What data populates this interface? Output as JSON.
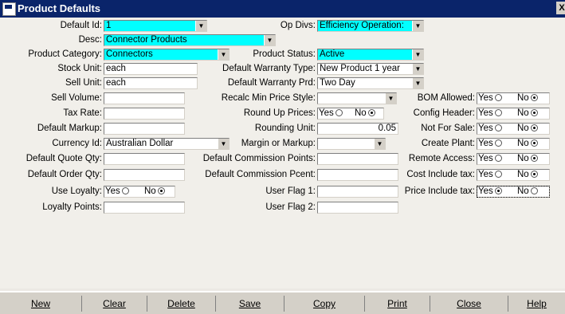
{
  "window": {
    "title": "Product Defaults",
    "close_glyph": "X"
  },
  "form": {
    "default_id": {
      "label": "Default Id:",
      "value": "1"
    },
    "op_divs": {
      "label": "Op Divs:",
      "value": "Efficiency Operation:"
    },
    "desc": {
      "label": "Desc:",
      "value": "Connector Products"
    },
    "product_category": {
      "label": "Product Category:",
      "value": "Connectors"
    },
    "product_status": {
      "label": "Product Status:",
      "value": "Active"
    },
    "stock_unit": {
      "label": "Stock Unit:",
      "value": "each"
    },
    "default_warranty_type": {
      "label": "Default Warranty Type:",
      "value": "New Product 1 year"
    },
    "sell_unit": {
      "label": "Sell Unit:",
      "value": "each"
    },
    "default_warranty_prd": {
      "label": "Default Warranty Prd:",
      "value": "Two Day"
    },
    "sell_volume": {
      "label": "Sell Volume:",
      "value": ""
    },
    "recalc_min_price_style": {
      "label": "Recalc Min Price Style:",
      "value": ""
    },
    "tax_rate": {
      "label": "Tax Rate:",
      "value": ""
    },
    "round_up_prices": {
      "label": "Round Up Prices:",
      "yes": "Yes",
      "no": "No",
      "selected": "No"
    },
    "default_markup": {
      "label": "Default Markup:",
      "value": ""
    },
    "rounding_unit": {
      "label": "Rounding Unit:",
      "value": "0.05"
    },
    "currency_id": {
      "label": "Currency Id:",
      "value": "Australian Dollar"
    },
    "margin_or_markup": {
      "label": "Margin or Markup:",
      "value": ""
    },
    "default_quote_qty": {
      "label": "Default Quote Qty:",
      "value": ""
    },
    "default_commission_points": {
      "label": "Default Commission Points:",
      "value": ""
    },
    "default_order_qty": {
      "label": "Default Order Qty:",
      "value": ""
    },
    "default_commission_pcent": {
      "label": "Default Commission Pcent:",
      "value": ""
    },
    "use_loyalty": {
      "label": "Use Loyalty:",
      "yes": "Yes",
      "no": "No",
      "selected": "No"
    },
    "user_flag_1": {
      "label": "User Flag 1:",
      "value": ""
    },
    "loyalty_points": {
      "label": "Loyalty Points:",
      "value": ""
    },
    "user_flag_2": {
      "label": "User Flag 2:",
      "value": ""
    },
    "bom_allowed": {
      "label": "BOM Allowed:",
      "yes": "Yes",
      "no": "No",
      "selected": "No"
    },
    "config_header": {
      "label": "Config Header:",
      "yes": "Yes",
      "no": "No",
      "selected": "No"
    },
    "not_for_sale": {
      "label": "Not For Sale:",
      "yes": "Yes",
      "no": "No",
      "selected": "No"
    },
    "create_plant": {
      "label": "Create Plant:",
      "yes": "Yes",
      "no": "No",
      "selected": "No"
    },
    "remote_access": {
      "label": "Remote Access:",
      "yes": "Yes",
      "no": "No",
      "selected": "No"
    },
    "cost_include_tax": {
      "label": "Cost Include tax:",
      "yes": "Yes",
      "no": "No",
      "selected": "No"
    },
    "price_include_tax": {
      "label": "Price Include tax:",
      "yes": "Yes",
      "no": "No",
      "selected": "Yes"
    }
  },
  "toolbar": {
    "new": "New",
    "clear": "Clear",
    "delete": "Delete",
    "save": "Save",
    "copy": "Copy",
    "print": "Print",
    "close": "Close",
    "help": "Help"
  },
  "colors": {
    "titlebar": "#0a246a",
    "highlight_field": "#00ffff",
    "face": "#d4d0c8"
  },
  "icons": {
    "dropdown": "chevron-down-icon",
    "app": "window-icon",
    "close": "close-icon"
  }
}
